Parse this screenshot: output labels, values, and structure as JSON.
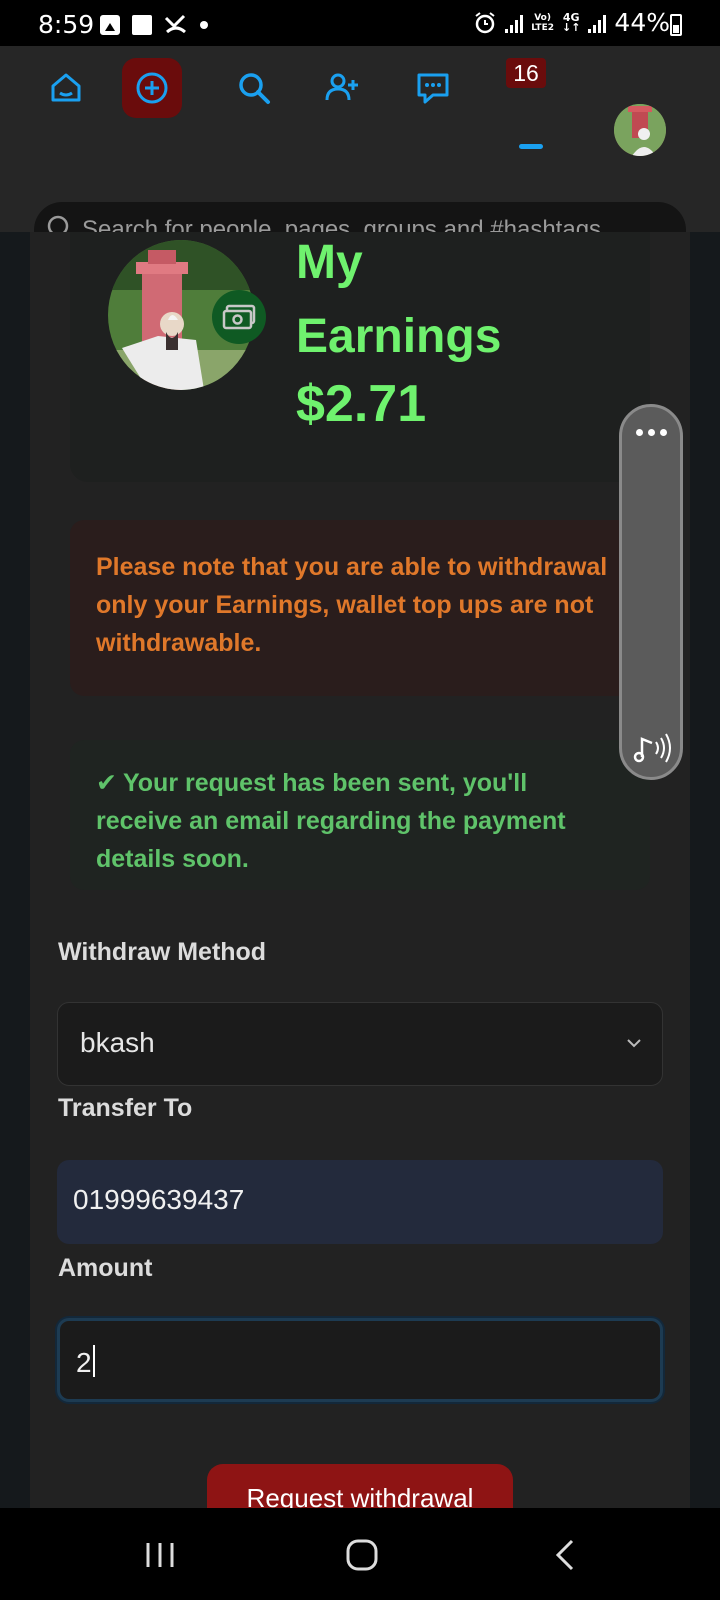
{
  "status_bar": {
    "time": "8:59",
    "network_top": "Vo)",
    "network_bottom": "LTE2",
    "net_type": "4G",
    "battery": "44%"
  },
  "header": {
    "notification_count": "16",
    "search_placeholder": "Search for people, pages, groups and #hashtags",
    "active_color": "#6a0c0c",
    "icon_color": "#1aa0f0",
    "icons": [
      "home-icon",
      "create-post-icon",
      "search-icon",
      "add-friend-icon",
      "messages-icon",
      "notifications-icon",
      "profile-avatar"
    ]
  },
  "earnings": {
    "title": "My Earnings",
    "amount": "$2.71"
  },
  "warning": {
    "text": "Please note that you are able to withdrawal only your Earnings, wallet top ups are not withdrawable."
  },
  "success": {
    "check": "✔",
    "text": "Your request has been sent, you'll receive an email regarding the payment details soon."
  },
  "form": {
    "method_label": "Withdraw Method",
    "method_value": "bkash",
    "transfer_label": "Transfer To",
    "transfer_value": "01999639437",
    "amount_label": "Amount",
    "amount_value": "2",
    "submit_label": "Request withdrawal"
  }
}
